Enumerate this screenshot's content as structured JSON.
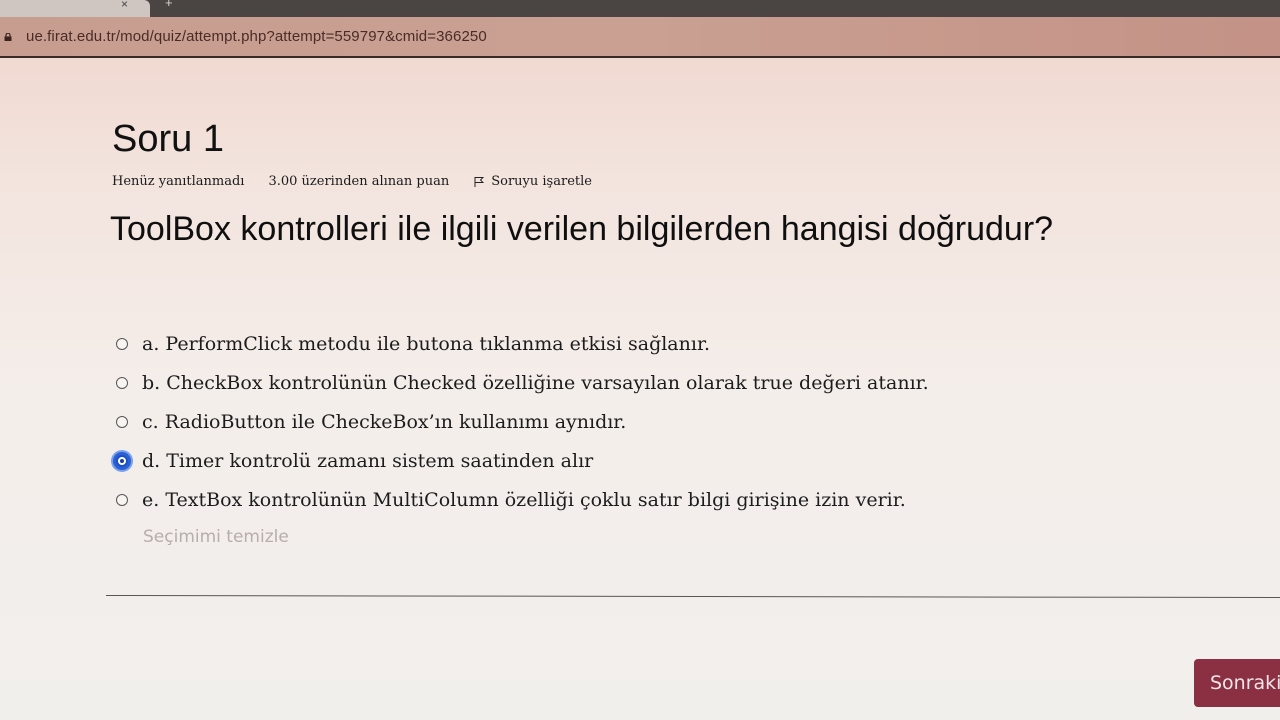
{
  "browser": {
    "url": "ue.firat.edu.tr/mod/quiz/attempt.php?attempt=559797&cmid=366250",
    "tab_close_glyph": "×",
    "new_tab_glyph": "+"
  },
  "question": {
    "title": "Soru 1",
    "status": "Henüz yanıtlanmadı",
    "mark": "3.00 üzerinden alınan puan",
    "flag_label": "Soruyu işaretle",
    "text": "ToolBox kontrolleri ile ilgili verilen bilgilerden hangisi doğrudur?",
    "answers": [
      {
        "label": "a. PerformClick metodu ile butona tıklanma etkisi sağlanır.",
        "selected": false
      },
      {
        "label": "b. CheckBox kontrolünün Checked özelliğine varsayılan olarak true değeri atanır.",
        "selected": false
      },
      {
        "label": "c. RadioButton ile CheckeBox’ın kullanımı aynıdır.",
        "selected": false
      },
      {
        "label": "d. Timer kontrolü zamanı sistem saatinden alır",
        "selected": true
      },
      {
        "label": "e. TextBox kontrolünün MultiColumn özelliği çoklu satır bilgi girişine izin verir.",
        "selected": false
      }
    ],
    "clear_choice": "Seçimimi temizle"
  },
  "navigation": {
    "next_label": "Sonraki"
  },
  "colors": {
    "next_button": "#8b2f43",
    "selected_radio": "#2b5fd2"
  },
  "icons": {
    "lock": "lock-icon",
    "flag": "flag-icon"
  }
}
